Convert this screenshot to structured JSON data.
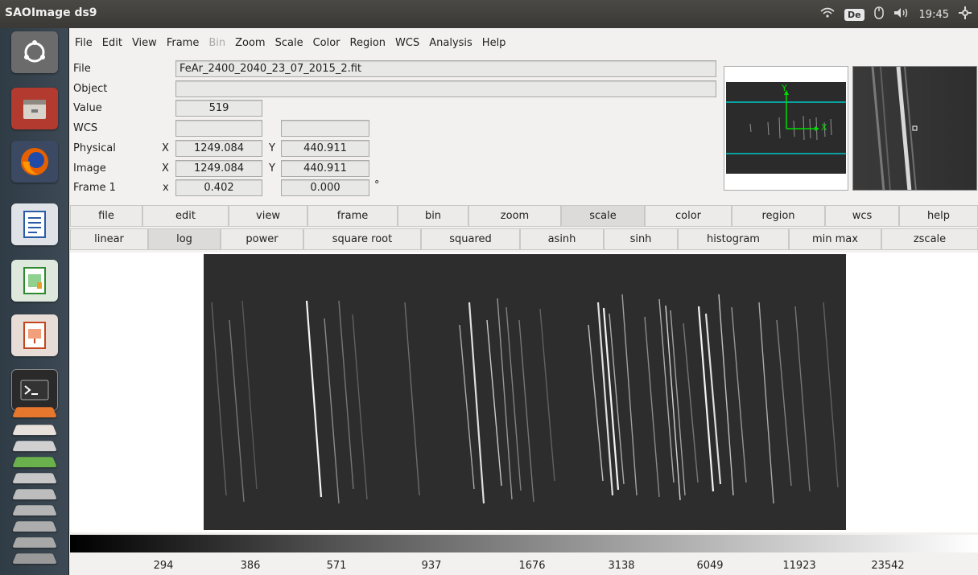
{
  "window": {
    "title": "SAOImage ds9"
  },
  "tray": {
    "keyboard": "De",
    "clock": "19:45"
  },
  "menubar": [
    "File",
    "Edit",
    "View",
    "Frame",
    "Bin",
    "Zoom",
    "Scale",
    "Color",
    "Region",
    "WCS",
    "Analysis",
    "Help"
  ],
  "info": {
    "labels": {
      "file": "File",
      "object": "Object",
      "value": "Value",
      "wcs": "WCS",
      "physical": "Physical",
      "image": "Image",
      "frame": "Frame 1"
    },
    "file": "FeAr_2400_2040_23_07_2015_2.fit",
    "object": "",
    "value": "519",
    "physical": {
      "x_tag": "X",
      "x": "1249.084",
      "y_tag": "Y",
      "y": "440.911"
    },
    "image": {
      "x_tag": "X",
      "x": "1249.084",
      "y_tag": "Y",
      "y": "440.911"
    },
    "frame": {
      "x_tag": "x",
      "zoom": "0.402",
      "angle": "0.000",
      "deg": "°"
    }
  },
  "panner": {
    "axis_y": "Y",
    "axis_x": "X",
    "colors": {
      "box": "#00c8c8",
      "axes": "#00dd00"
    }
  },
  "buttonbar": [
    "file",
    "edit",
    "view",
    "frame",
    "bin",
    "zoom",
    "scale",
    "color",
    "region",
    "wcs",
    "help"
  ],
  "scalebar": [
    "linear",
    "log",
    "power",
    "square root",
    "squared",
    "asinh",
    "sinh",
    "histogram",
    "min max",
    "zscale"
  ],
  "colorbar": [
    "294",
    "386",
    "571",
    "937",
    "1676",
    "3138",
    "6049",
    "11923",
    "23542"
  ]
}
